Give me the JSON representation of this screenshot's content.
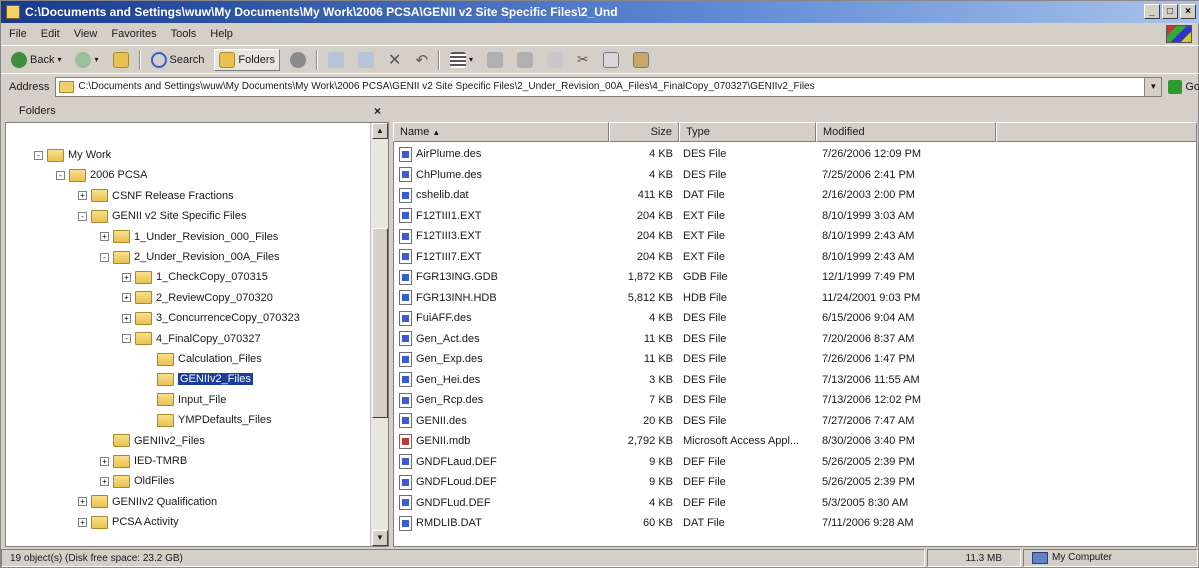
{
  "window": {
    "title": "C:\\Documents and Settings\\wuw\\My Documents\\My Work\\2006 PCSA\\GENII v2 Site Specific Files\\2_Und",
    "controls": [
      "_",
      "□",
      "×"
    ]
  },
  "menu": [
    "File",
    "Edit",
    "View",
    "Favorites",
    "Tools",
    "Help"
  ],
  "toolbar": {
    "back_label": "Back",
    "search_label": "Search",
    "folders_label": "Folders"
  },
  "address": {
    "label": "Address",
    "value": "C:\\Documents and Settings\\wuw\\My Documents\\My Work\\2006 PCSA\\GENII v2 Site Specific Files\\2_Under_Revision_00A_Files\\4_FinalCopy_070327\\GENIIv2_Files",
    "go_label": "Go"
  },
  "folders_pane": {
    "title": "Folders",
    "close": "×",
    "tree": [
      {
        "label": "My Work",
        "level": 0,
        "toggle": "-"
      },
      {
        "label": "2006 PCSA",
        "level": 1,
        "toggle": "-"
      },
      {
        "label": "CSNF Release Fractions",
        "level": 2,
        "toggle": "+"
      },
      {
        "label": "GENII v2 Site Specific Files",
        "level": 2,
        "toggle": "-"
      },
      {
        "label": "1_Under_Revision_000_Files",
        "level": 3,
        "toggle": "+"
      },
      {
        "label": "2_Under_Revision_00A_Files",
        "level": 3,
        "toggle": "-"
      },
      {
        "label": "1_CheckCopy_070315",
        "level": 4,
        "toggle": "+"
      },
      {
        "label": "2_ReviewCopy_070320",
        "level": 4,
        "toggle": "+"
      },
      {
        "label": "3_ConcurrenceCopy_070323",
        "level": 4,
        "toggle": "+"
      },
      {
        "label": "4_FinalCopy_070327",
        "level": 4,
        "toggle": "-"
      },
      {
        "label": "Calculation_Files",
        "level": 5,
        "toggle": ""
      },
      {
        "label": "GENIIv2_Files",
        "level": 5,
        "toggle": "",
        "selected": true
      },
      {
        "label": "Input_File",
        "level": 5,
        "toggle": ""
      },
      {
        "label": "YMPDefaults_Files",
        "level": 5,
        "toggle": ""
      },
      {
        "label": "GENIIv2_Files",
        "level": 3,
        "toggle": ""
      },
      {
        "label": "IED-TMRB",
        "level": 3,
        "toggle": "+"
      },
      {
        "label": "OldFiles",
        "level": 3,
        "toggle": "+"
      },
      {
        "label": "GENIIv2 Qualification",
        "level": 2,
        "toggle": "+"
      },
      {
        "label": "PCSA Activity",
        "level": 2,
        "toggle": "+"
      }
    ]
  },
  "files_pane": {
    "columns": {
      "name": "Name",
      "size": "Size",
      "type": "Type",
      "modified": "Modified"
    },
    "files": [
      {
        "name": "AirPlume.des",
        "size": "4 KB",
        "type": "DES File",
        "modified": "7/26/2006 12:09 PM",
        "icon": "file"
      },
      {
        "name": "ChPlume.des",
        "size": "4 KB",
        "type": "DES File",
        "modified": "7/25/2006 2:41 PM",
        "icon": "file"
      },
      {
        "name": "cshelib.dat",
        "size": "411 KB",
        "type": "DAT File",
        "modified": "2/16/2003 2:00 PM",
        "icon": "file"
      },
      {
        "name": "F12TIII1.EXT",
        "size": "204 KB",
        "type": "EXT File",
        "modified": "8/10/1999 3:03 AM",
        "icon": "file"
      },
      {
        "name": "F12TIII3.EXT",
        "size": "204 KB",
        "type": "EXT File",
        "modified": "8/10/1999 2:43 AM",
        "icon": "file"
      },
      {
        "name": "F12TIII7.EXT",
        "size": "204 KB",
        "type": "EXT File",
        "modified": "8/10/1999 2:43 AM",
        "icon": "file"
      },
      {
        "name": "FGR13ING.GDB",
        "size": "1,872 KB",
        "type": "GDB File",
        "modified": "12/1/1999 7:49 PM",
        "icon": "file"
      },
      {
        "name": "FGR13INH.HDB",
        "size": "5,812 KB",
        "type": "HDB File",
        "modified": "11/24/2001 9:03 PM",
        "icon": "file"
      },
      {
        "name": "FuiAFF.des",
        "size": "4 KB",
        "type": "DES File",
        "modified": "6/15/2006 9:04 AM",
        "icon": "file"
      },
      {
        "name": "Gen_Act.des",
        "size": "11 KB",
        "type": "DES File",
        "modified": "7/20/2006 8:37 AM",
        "icon": "file"
      },
      {
        "name": "Gen_Exp.des",
        "size": "11 KB",
        "type": "DES File",
        "modified": "7/26/2006 1:47 PM",
        "icon": "file"
      },
      {
        "name": "Gen_Hei.des",
        "size": "3 KB",
        "type": "DES File",
        "modified": "7/13/2006 11:55 AM",
        "icon": "file"
      },
      {
        "name": "Gen_Rcp.des",
        "size": "7 KB",
        "type": "DES File",
        "modified": "7/13/2006 12:02 PM",
        "icon": "file"
      },
      {
        "name": "GENII.des",
        "size": "20 KB",
        "type": "DES File",
        "modified": "7/27/2006 7:47 AM",
        "icon": "file"
      },
      {
        "name": "GENII.mdb",
        "size": "2,792 KB",
        "type": "Microsoft Access Appl...",
        "modified": "8/30/2006 3:40 PM",
        "icon": "mdb"
      },
      {
        "name": "GNDFLaud.DEF",
        "size": "9 KB",
        "type": "DEF File",
        "modified": "5/26/2005 2:39 PM",
        "icon": "file"
      },
      {
        "name": "GNDFLoud.DEF",
        "size": "9 KB",
        "type": "DEF File",
        "modified": "5/26/2005 2:39 PM",
        "icon": "file"
      },
      {
        "name": "GNDFLud.DEF",
        "size": "4 KB",
        "type": "DEF File",
        "modified": "5/3/2005 8:30 AM",
        "icon": "file"
      },
      {
        "name": "RMDLIB.DAT",
        "size": "60 KB",
        "type": "DAT File",
        "modified": "7/11/2006 9:28 AM",
        "icon": "file"
      }
    ]
  },
  "status": {
    "objects": "19 object(s) (Disk free space: 23.2 GB)",
    "size": "11.3 MB",
    "zone": "My Computer"
  }
}
